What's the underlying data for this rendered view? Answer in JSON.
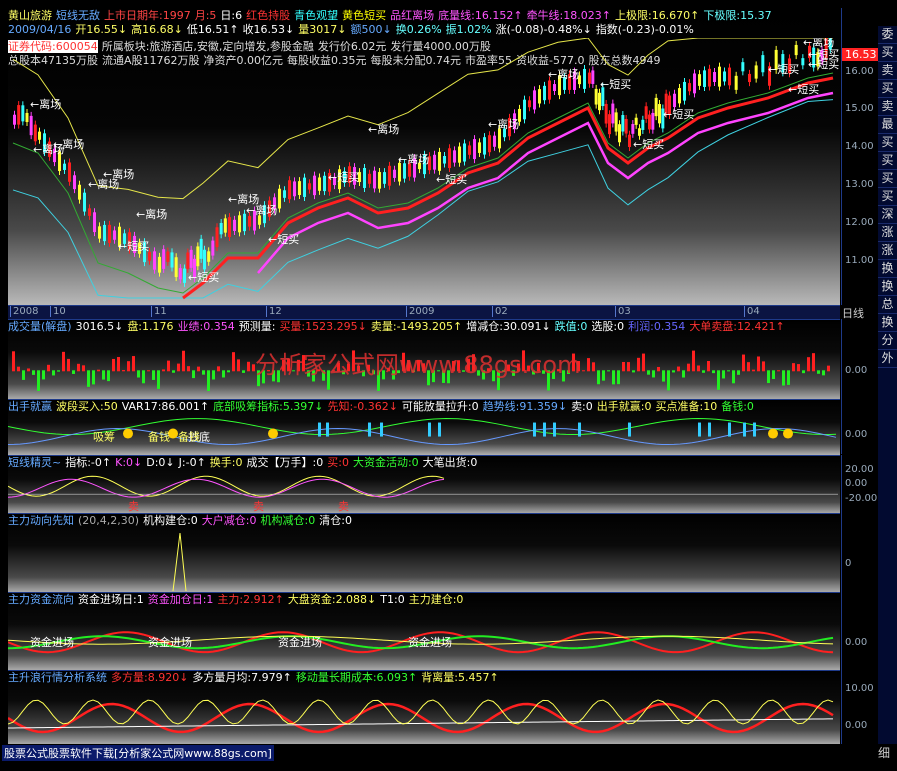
{
  "main_chart": {
    "header_row1": [
      {
        "text": "黄山旅游",
        "color": "#ffff66"
      },
      {
        "text": "短线无敌",
        "color": "#66aaff"
      },
      {
        "text": "上市日期年:1997",
        "color": "#ff4444"
      },
      {
        "text": "月:5",
        "color": "#ff4444"
      },
      {
        "text": "日:6",
        "color": "#ffffff"
      },
      {
        "text": "红色持股",
        "color": "#ff3333"
      },
      {
        "text": "青色观望",
        "color": "#33ffff"
      },
      {
        "text": "黄色短买",
        "color": "#ffff00"
      },
      {
        "text": "品红离场",
        "color": "#ff55ff"
      },
      {
        "text": "底量线:16.152↑",
        "color": "#ff55ff"
      },
      {
        "text": "牵牛线:18.023↑",
        "color": "#ff55ff"
      },
      {
        "text": "上极限:16.670↑",
        "color": "#ffff66"
      },
      {
        "text": "下极限:15.37",
        "color": "#66ffff"
      }
    ],
    "header_row2": [
      {
        "text": "2009/04/16",
        "color": "#66aaff"
      },
      {
        "text": "开16.55↓",
        "color": "#ffff66"
      },
      {
        "text": "高16.68↓",
        "color": "#ffff66"
      },
      {
        "text": "低16.51↑",
        "color": "#ffffff"
      },
      {
        "text": "收16.53↓",
        "color": "#ffffff"
      },
      {
        "text": "量3017↓",
        "color": "#ffff66"
      },
      {
        "text": "额500↓",
        "color": "#66aaff"
      },
      {
        "text": "换0.26%",
        "color": "#66ffff"
      },
      {
        "text": "振1.02%",
        "color": "#66ffff"
      },
      {
        "text": "涨(-0.08)-0.48%↓",
        "color": "#ffffff"
      },
      {
        "text": "指数(-0.23)-0.01%",
        "color": "#ffffff"
      }
    ],
    "info_row1": [
      {
        "text": "证券代码:600054",
        "color": "#ff3333",
        "bg": "#ffffff"
      },
      {
        "text": "所属板块:旅游酒店,安徽,定向增发,参股金融",
        "color": "#dddddd"
      },
      {
        "text": "发行价6.02元",
        "color": "#dddddd"
      },
      {
        "text": "发行量4000.00万股",
        "color": "#dddddd"
      }
    ],
    "info_row2": [
      {
        "text": "总股本47135万股",
        "color": "#dddddd"
      },
      {
        "text": "流通A股11762万股",
        "color": "#dddddd"
      },
      {
        "text": "净资产0.00亿元",
        "color": "#dddddd"
      },
      {
        "text": "每股收益0.35元",
        "color": "#dddddd"
      },
      {
        "text": "每股未分配0.74元",
        "color": "#dddddd"
      },
      {
        "text": "市盈率55",
        "color": "#dddddd"
      },
      {
        "text": "资收益-577.0",
        "color": "#dddddd"
      },
      {
        "text": "股东总数4949",
        "color": "#dddddd"
      }
    ],
    "price_badge": "16.53",
    "y_ticks": [
      "16.00",
      "15.00",
      "14.00",
      "13.00",
      "12.00",
      "11.00"
    ],
    "x_labels": [
      "2008",
      "10",
      "11",
      "12",
      "2009",
      "02",
      "03",
      "04"
    ],
    "period_label": "日线",
    "annotations": [
      {
        "text": "←离场",
        "color": "#ffffff"
      },
      {
        "text": "←离场",
        "color": "#ffffff"
      },
      {
        "text": "←离场",
        "color": "#ffffff"
      },
      {
        "text": "←离场",
        "color": "#ffffff"
      },
      {
        "text": "←离场",
        "color": "#ffffff"
      },
      {
        "text": "←离场",
        "color": "#ffffff"
      },
      {
        "text": "←离场",
        "color": "#ffffff"
      },
      {
        "text": "←离场",
        "color": "#ffffff"
      },
      {
        "text": "←离场",
        "color": "#ffffff"
      },
      {
        "text": "←离场",
        "color": "#ffffff"
      },
      {
        "text": "←离场",
        "color": "#ffffff"
      },
      {
        "text": "←离场",
        "color": "#ffffff"
      },
      {
        "text": "←离场",
        "color": "#ffffff"
      },
      {
        "text": "←短买",
        "color": "#ffffff"
      },
      {
        "text": "←短买",
        "color": "#ffffff"
      },
      {
        "text": "←短买",
        "color": "#ffffff"
      },
      {
        "text": "←短买",
        "color": "#ffffff"
      },
      {
        "text": "←短买",
        "color": "#ffffff"
      },
      {
        "text": "←短买",
        "color": "#ffffff"
      },
      {
        "text": "←短买",
        "color": "#ffffff"
      },
      {
        "text": "←短买",
        "color": "#ffffff"
      },
      {
        "text": "←短买",
        "color": "#ffffff"
      },
      {
        "text": "←短买",
        "color": "#ffffff"
      },
      {
        "text": "←短买",
        "color": "#ffffff"
      },
      {
        "text": "←短买",
        "color": "#ffffff"
      }
    ]
  },
  "watermark": "分析家公式网www.88gs.com",
  "panels": [
    {
      "id": "volume",
      "header": [
        {
          "text": "成交量(解盘)",
          "color": "#66aaff"
        },
        {
          "text": "3016.5↓",
          "color": "#ffffff"
        },
        {
          "text": "盘:1.176",
          "color": "#ffff66"
        },
        {
          "text": "业绩:0.354",
          "color": "#ff55ff"
        },
        {
          "text": "预测量:",
          "color": "#ffffff"
        },
        {
          "text": "买量:1523.295↓",
          "color": "#ff3333"
        },
        {
          "text": "卖量:-1493.205↑",
          "color": "#ffff66"
        },
        {
          "text": "增减仓:30.091↓",
          "color": "#ffffff"
        },
        {
          "text": "跌值:0",
          "color": "#66ffff"
        },
        {
          "text": "选股:0",
          "color": "#ffffff"
        },
        {
          "text": "利润:0.354",
          "color": "#6666ff"
        },
        {
          "text": "大单卖盘:12.421↑",
          "color": "#ff3333"
        }
      ],
      "ticks": [
        "0.00"
      ]
    },
    {
      "id": "chushou",
      "header": [
        {
          "text": "出手就赢",
          "color": "#66aaff"
        },
        {
          "text": "波段买入:50",
          "color": "#ffff66"
        },
        {
          "text": "VAR17:86.001↑",
          "color": "#ffffff"
        },
        {
          "text": "底部吸筹指标:5.397↓",
          "color": "#33ff33"
        },
        {
          "text": "先知:-0.362↓",
          "color": "#ff3333"
        },
        {
          "text": "可能放量拉升:0",
          "color": "#ffffff"
        },
        {
          "text": "趋势线:91.359↓",
          "color": "#66aaff"
        },
        {
          "text": "卖:0",
          "color": "#ffffff"
        },
        {
          "text": "出手就赢:0",
          "color": "#ffff66"
        },
        {
          "text": "买点准备:10",
          "color": "#ffff66"
        },
        {
          "text": "备钱:0",
          "color": "#33ff33"
        }
      ],
      "ticks": [
        "0.00"
      ],
      "labels": [
        {
          "text": "吸筹",
          "color": "#ffff66"
        },
        {
          "text": "抄底",
          "color": "#ffffff"
        },
        {
          "text": "备钱",
          "color": "#ffff66"
        },
        {
          "text": "备钱",
          "color": "#ffff66"
        }
      ]
    },
    {
      "id": "duanxian",
      "header": [
        {
          "text": "短线精灵~",
          "color": "#66aaff"
        },
        {
          "text": "指标:-0↑",
          "color": "#ffffff"
        },
        {
          "text": "K:0↓",
          "color": "#ff55ff"
        },
        {
          "text": "D:0↓",
          "color": "#ffffff"
        },
        {
          "text": "J:-0↑",
          "color": "#ffffff"
        },
        {
          "text": "换手:0",
          "color": "#ffff66"
        },
        {
          "text": "成交【万手】:0",
          "color": "#ffffff"
        },
        {
          "text": "买:0",
          "color": "#ff3333"
        },
        {
          "text": "大资金活动:0",
          "color": "#33ff33"
        },
        {
          "text": "大笔出货:0",
          "color": "#ffffff"
        }
      ],
      "ticks": [
        "20.00",
        "0.00",
        "-20.00"
      ],
      "labels": [
        {
          "text": "卖",
          "color": "#ff3333"
        },
        {
          "text": "卖",
          "color": "#ff3333"
        },
        {
          "text": "卖",
          "color": "#ff3333"
        }
      ]
    },
    {
      "id": "zhuli_dongxiang",
      "header": [
        {
          "text": "主力动向先知",
          "color": "#66aaff"
        },
        {
          "text": "(20,4,2,30)",
          "color": "#aaaaaa"
        },
        {
          "text": "机构建仓:0",
          "color": "#ffffff"
        },
        {
          "text": "大户减仓:0",
          "color": "#ff55ff"
        },
        {
          "text": "机构减仓:0",
          "color": "#33ff33"
        },
        {
          "text": "清仓:0",
          "color": "#ffffff"
        }
      ],
      "ticks": [
        "0"
      ]
    },
    {
      "id": "zijin",
      "header": [
        {
          "text": "主力资金流向",
          "color": "#66aaff"
        },
        {
          "text": "资金进场日:1",
          "color": "#ffffff"
        },
        {
          "text": "资金加仓日:1",
          "color": "#ff55ff"
        },
        {
          "text": "主力:2.912↑",
          "color": "#ff3333"
        },
        {
          "text": "大盘资金:2.088↓",
          "color": "#ffff66"
        },
        {
          "text": "T1:0",
          "color": "#ffffff"
        },
        {
          "text": "主力建仓:0",
          "color": "#ffff66"
        }
      ],
      "ticks": [
        "0.00"
      ],
      "labels": [
        {
          "text": "资金进场",
          "color": "#ffffff"
        },
        {
          "text": "资金进场",
          "color": "#ffffff"
        },
        {
          "text": "资金进场",
          "color": "#ffffff"
        },
        {
          "text": "资金进场",
          "color": "#ffffff"
        }
      ]
    },
    {
      "id": "zhusheng",
      "header": [
        {
          "text": "主升浪行情分析系统",
          "color": "#66aaff"
        },
        {
          "text": "多方量:8.920↓",
          "color": "#ff3333"
        },
        {
          "text": "多方量月均:7.979↑",
          "color": "#ffffff"
        },
        {
          "text": "移动量长期成本:6.093↑",
          "color": "#33ff33"
        },
        {
          "text": "背离量:5.457↑",
          "color": "#ffff66"
        }
      ],
      "ticks": [
        "10.00",
        "0.00"
      ]
    }
  ],
  "side_tabs": [
    "委",
    "买",
    "卖",
    "买",
    "卖",
    "最",
    "买",
    "买",
    "买",
    "买",
    "深",
    "涨",
    "涨",
    "换",
    "换",
    "总",
    "换",
    "分",
    "外"
  ],
  "bottom_text": "股票公式股票软件下载[分析家公式网www.88gs.com]",
  "bottom_right": "细"
}
